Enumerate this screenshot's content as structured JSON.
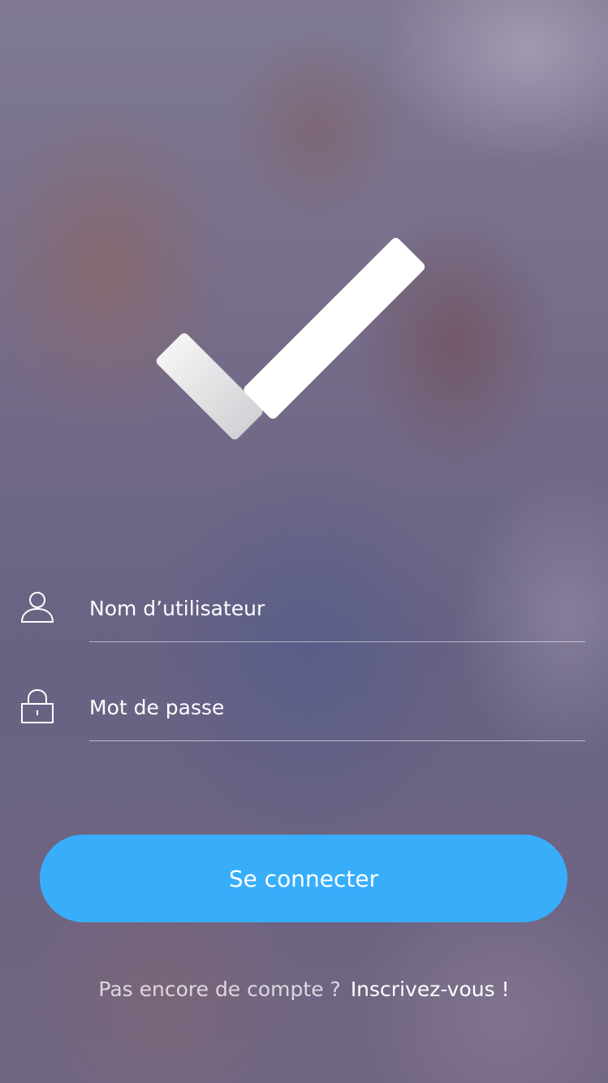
{
  "app": {
    "accent_color": "#38aefb",
    "logo_icon": "checkmark-icon"
  },
  "form": {
    "username": {
      "icon": "user-icon",
      "placeholder": "Nom d’utilisateur",
      "value": ""
    },
    "password": {
      "icon": "lock-icon",
      "placeholder": "Mot de passe",
      "value": ""
    },
    "submit_label": "Se connecter"
  },
  "signup": {
    "prompt": "Pas encore de compte ?",
    "link_label": "Inscrivez-vous !"
  }
}
